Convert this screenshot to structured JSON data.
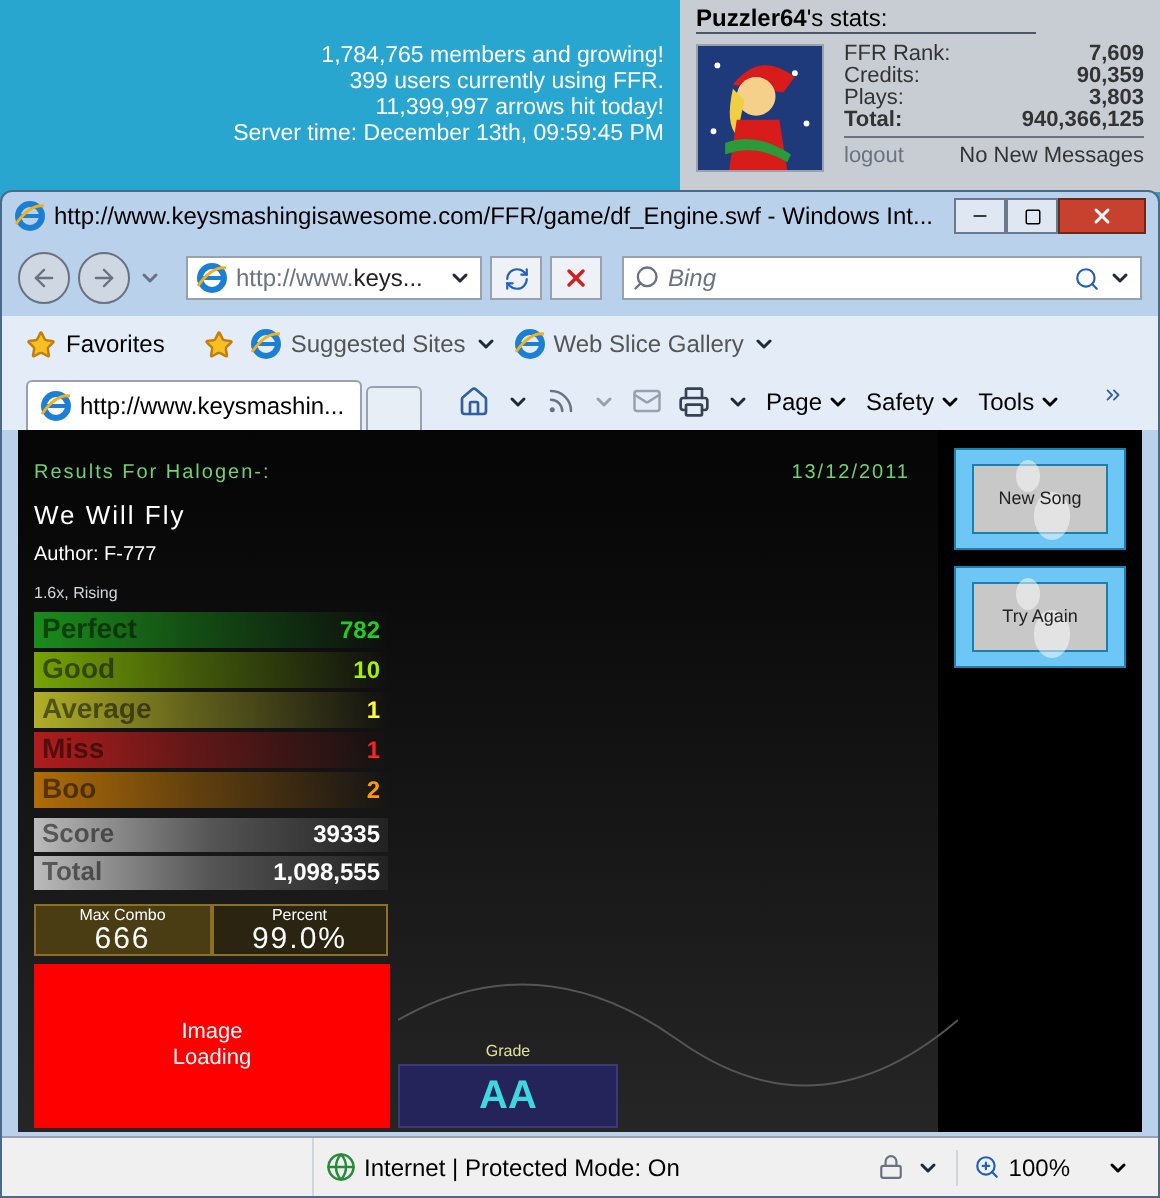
{
  "desktop": {
    "site_stats": [
      "1,784,765 members and growing!",
      "399 users currently using FFR.",
      "11,399,997 arrows hit today!",
      "Server time: December 13th, 09:59:45 PM"
    ]
  },
  "user_panel": {
    "username": "Puzzler64",
    "title_suffix": "'s stats:",
    "stats": [
      {
        "label": "FFR Rank:",
        "value": "7,609"
      },
      {
        "label": "Credits:",
        "value": "90,359"
      },
      {
        "label": "Plays:",
        "value": "3,803"
      }
    ],
    "total": {
      "label": "Total:",
      "value": "940,366,125"
    },
    "logout": "logout",
    "messages": "No New Messages"
  },
  "window": {
    "title": "http://www.keysmashingisawesome.com/FFR/game/df_Engine.swf - Windows Int..."
  },
  "address_bar": {
    "value": "http://www.**keys...**"
  },
  "search": {
    "placeholder": "Bing"
  },
  "favorites_bar": {
    "favorites": "Favorites",
    "links": [
      "Suggested Sites",
      "Web Slice Gallery"
    ]
  },
  "tabs": [
    {
      "label": "http://www.keysmashin...",
      "selected": true
    }
  ],
  "command_bar": [
    "Page",
    "Safety",
    "Tools"
  ],
  "game": {
    "results_for": "Results For Halogen-:",
    "date": "13/12/2011",
    "song": "We Will Fly",
    "author": "Author: F-777",
    "mods": "1.6x, Rising",
    "judgements": [
      {
        "label": "Perfect",
        "value": "782",
        "color": "#22cc22"
      },
      {
        "label": "Good",
        "value": "10",
        "color": "#aaee00"
      },
      {
        "label": "Average",
        "value": "1",
        "color": "#ffff33"
      },
      {
        "label": "Miss",
        "value": "1",
        "color": "#ff2222"
      },
      {
        "label": "Boo",
        "value": "2",
        "color": "#ff9900"
      }
    ],
    "totals": [
      {
        "label": "Score",
        "value": "39335"
      },
      {
        "label": "Total",
        "value": "1,098,555"
      }
    ],
    "max_combo": {
      "label": "Max Combo",
      "value": "666"
    },
    "percent": {
      "label": "Percent",
      "value": "99.0%"
    },
    "image": "Image Loading",
    "grade": {
      "label": "Grade",
      "value": "AA"
    },
    "buttons": [
      "New Song",
      "Try Again"
    ]
  },
  "status_bar": {
    "zone": "Internet | Protected Mode: On",
    "zoom": "100%"
  }
}
